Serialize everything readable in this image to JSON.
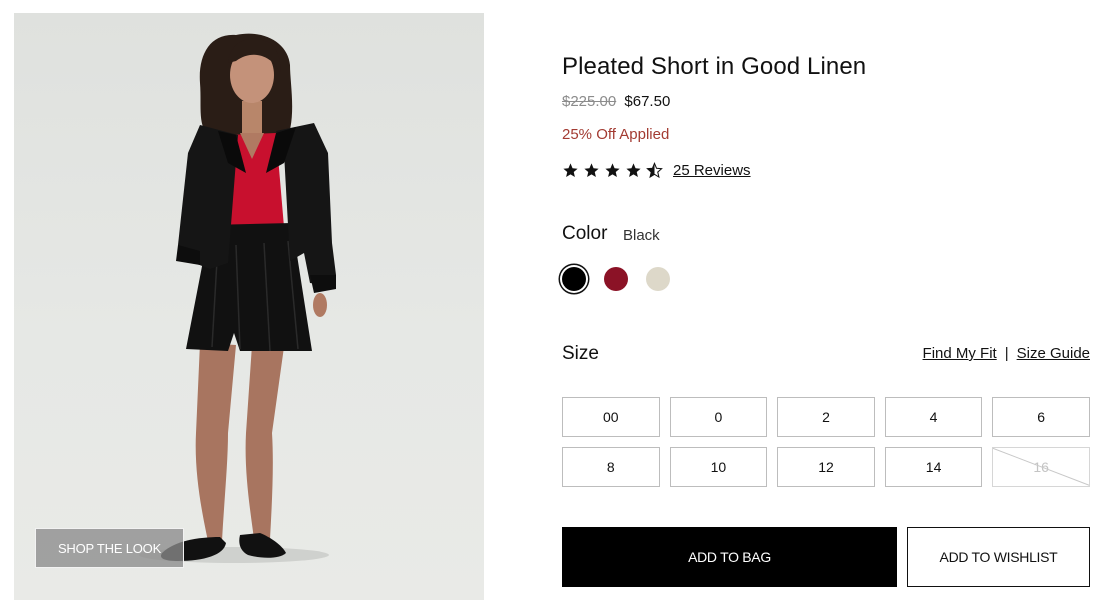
{
  "product": {
    "title": "Pleated Short in Good Linen",
    "price_original": "$225.00",
    "price_sale": "$67.50",
    "discount_text": "25% Off Applied",
    "rating": 4.5,
    "rating_max": 5,
    "reviews_label": "25 Reviews"
  },
  "image": {
    "shop_look_label": "SHOP THE LOOK"
  },
  "color": {
    "label": "Color",
    "selected": "Black",
    "swatches": [
      {
        "name": "Black",
        "hex": "#000000",
        "selected": true
      },
      {
        "name": "Red",
        "hex": "#8b1226",
        "selected": false
      },
      {
        "name": "Cream",
        "hex": "#ddd8c9",
        "selected": false
      }
    ]
  },
  "size": {
    "label": "Size",
    "find_fit_label": "Find My Fit",
    "separator": "|",
    "size_guide_label": "Size Guide",
    "options": [
      {
        "label": "00",
        "available": true
      },
      {
        "label": "0",
        "available": true
      },
      {
        "label": "2",
        "available": true
      },
      {
        "label": "4",
        "available": true
      },
      {
        "label": "6",
        "available": true
      },
      {
        "label": "8",
        "available": true
      },
      {
        "label": "10",
        "available": true
      },
      {
        "label": "12",
        "available": true
      },
      {
        "label": "14",
        "available": true
      },
      {
        "label": "16",
        "available": false
      }
    ]
  },
  "actions": {
    "add_to_bag": "ADD TO BAG",
    "add_to_wishlist": "ADD TO WISHLIST"
  },
  "colors": {
    "discount_text": "#a33b32",
    "primary_button": "#000000",
    "star": "#111111"
  },
  "icons": {
    "star_full": "star-icon",
    "star_half": "half-star-icon"
  }
}
